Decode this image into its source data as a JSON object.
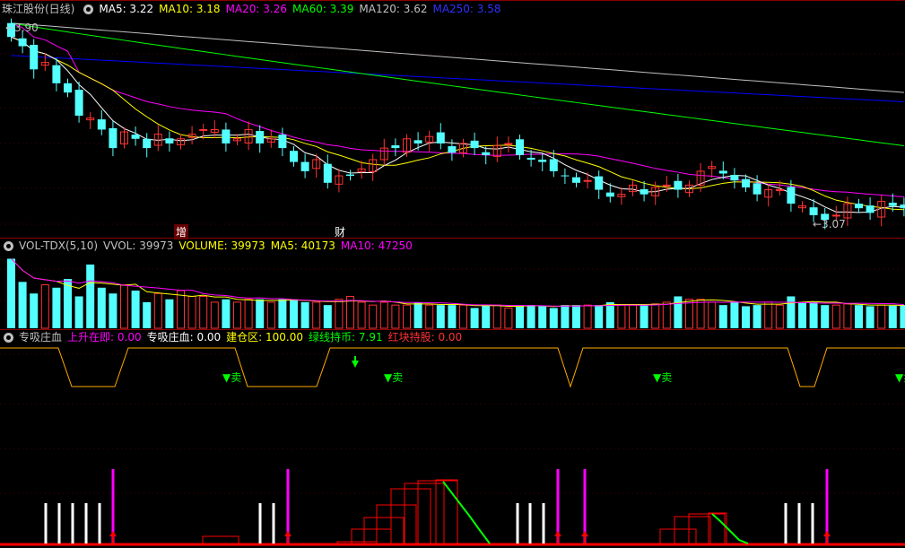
{
  "main_header": {
    "title": "珠江股份(日线)",
    "ma5": "MA5: 3.22",
    "ma10": "MA10: 3.18",
    "ma20": "MA20: 3.26",
    "ma60": "MA60: 3.39",
    "ma120": "MA120: 3.62",
    "ma250": "MA250: 3.58"
  },
  "price_labels": {
    "high": "←3.90",
    "low": "←3.07",
    "marker_zeng": "增",
    "marker_cai": "财"
  },
  "vol_header": {
    "name": "VOL-TDX(5,10)",
    "vvol": "VVOL: 39973",
    "volume": "VOLUME: 39973",
    "ma5": "MA5: 40173",
    "ma10": "MA10: 47250"
  },
  "ind_header": {
    "name": "专吸庄血",
    "rise": "上升在即: 0.00",
    "absorb": "专吸庄血: 0.00",
    "build": "建仓区: 100.00",
    "green": "绿线持币: 7.91",
    "red": "红块持股: 0.00"
  },
  "sell_label": "▼卖",
  "colors": {
    "up": "#ff3232",
    "down": "#54ffff",
    "ma5": "#ffffff",
    "ma10": "#ffff00",
    "ma20": "#ff00ff",
    "ma60": "#00ff00",
    "ma120": "#c0c0c0",
    "ma250": "#0000ff",
    "ma_vol10": "#ff00ff",
    "signal_line": "#ffaa00",
    "sell": "#00ff00",
    "pink": "#ff00ff",
    "white": "#ffffff",
    "red": "#ff0000"
  },
  "chart_data": {
    "type": "candlestick",
    "closes": [
      3.86,
      3.82,
      3.72,
      3.75,
      3.66,
      3.62,
      3.52,
      3.51,
      3.46,
      3.38,
      3.45,
      3.42,
      3.38,
      3.44,
      3.4,
      3.42,
      3.44,
      3.46,
      3.46,
      3.4,
      3.42,
      3.46,
      3.4,
      3.42,
      3.38,
      3.32,
      3.28,
      3.33,
      3.23,
      3.26,
      3.26,
      3.29,
      3.33,
      3.38,
      3.38,
      3.42,
      3.4,
      3.43,
      3.4,
      3.36,
      3.4,
      3.38,
      3.35,
      3.39,
      3.4,
      3.35,
      3.33,
      3.32,
      3.28,
      3.26,
      3.23,
      3.24,
      3.2,
      3.17,
      3.18,
      3.22,
      3.18,
      3.21,
      3.22,
      3.2,
      3.22,
      3.28,
      3.3,
      3.27,
      3.24,
      3.21,
      3.18,
      3.2,
      3.2,
      3.14,
      3.13,
      3.09,
      3.07,
      3.09,
      3.14,
      3.12,
      3.1,
      3.15,
      3.13,
      3.12
    ],
    "volumes": [
      120,
      80,
      60,
      75,
      70,
      85,
      55,
      110,
      70,
      60,
      75,
      65,
      45,
      60,
      50,
      65,
      55,
      55,
      45,
      50,
      45,
      50,
      50,
      45,
      50,
      50,
      45,
      45,
      40,
      50,
      55,
      45,
      40,
      45,
      40,
      40,
      45,
      40,
      40,
      40,
      40,
      35,
      40,
      40,
      35,
      40,
      40,
      38,
      35,
      40,
      40,
      40,
      40,
      45,
      40,
      40,
      40,
      42,
      45,
      55,
      50,
      50,
      45,
      40,
      45,
      38,
      40,
      45,
      40,
      55,
      45,
      45,
      40,
      40,
      42,
      40,
      38,
      40,
      39,
      40
    ],
    "ma_values": {
      "MA5": 3.22,
      "MA10": 3.18,
      "MA20": 3.26,
      "MA60": 3.39,
      "MA120": 3.62,
      "MA250": 3.58
    },
    "high_label": 3.9,
    "low_label": 3.07
  }
}
